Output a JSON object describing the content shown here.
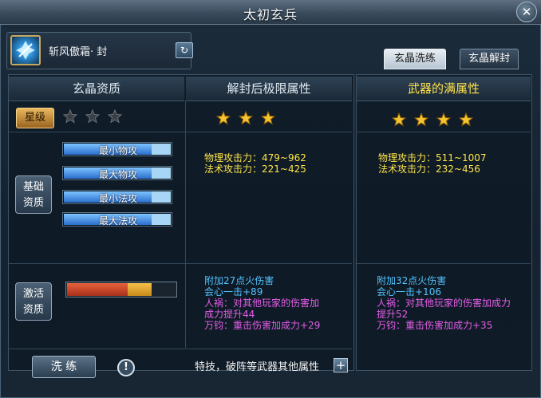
{
  "window": {
    "title": "太初玄兵",
    "close_icon": "close-icon"
  },
  "weapon": {
    "name": "斩风傲霜· 封",
    "icon": "crystal-sword-icon",
    "refresh_icon": "refresh-icon"
  },
  "tabs": [
    {
      "label": "玄晶洗练",
      "active": true
    },
    {
      "label": "玄晶解封",
      "active": false
    }
  ],
  "columns": {
    "aptitude": "玄晶资质",
    "unseal_limit": "解封后极限属性",
    "full_attrs": "武器的满属性"
  },
  "star_level": {
    "label": "星级",
    "current_stars": 0,
    "max_stars": 3,
    "unseal_stars": 3,
    "full_stars": 4
  },
  "basic_aptitude": {
    "label": "基础资质",
    "label_line1": "基础",
    "label_line2": "资质",
    "bars": [
      {
        "label": "最小物攻",
        "fill": 0.82
      },
      {
        "label": "最大物攻",
        "fill": 0.82
      },
      {
        "label": "最小法攻",
        "fill": 0.82
      },
      {
        "label": "最大法攻",
        "fill": 0.82
      }
    ]
  },
  "unseal_stats": {
    "phys_attack": "物理攻击力：479~962",
    "magic_attack": "法术攻击力：221~425",
    "fire_damage": "附加27点火伤害",
    "critical": "会心一击+89",
    "bane_line1": "人祸：对其他玩家的伤害加",
    "bane_line2": "成力提升44",
    "wanjun": "万钧：重击伤害加成力+29"
  },
  "full_stats": {
    "phys_attack": "物理攻击力：511~1007",
    "magic_attack": "法术攻击力：232~456",
    "fire_damage": "附加32点火伤害",
    "critical": "会心一击+106",
    "bane_line1": "人祸：对其他玩家的伤害加成力",
    "bane_line2": "提升52",
    "wanjun": "万钧：重击伤害加成力+35"
  },
  "activation": {
    "label_line1": "激活",
    "label_line2": "资质",
    "red_fill": 0.56,
    "orange_fill": 0.22
  },
  "bottom": {
    "wash_button": "洗 练",
    "info_icon": "info-icon",
    "special_text": "特技，破阵等武器其他属性",
    "plus_icon": "plus-icon"
  },
  "colors": {
    "yellow_stat": "#ffe54a",
    "blue_stat": "#53c3ff",
    "pink_stat": "#e45de8",
    "header_highlight": "#ffe14a"
  }
}
